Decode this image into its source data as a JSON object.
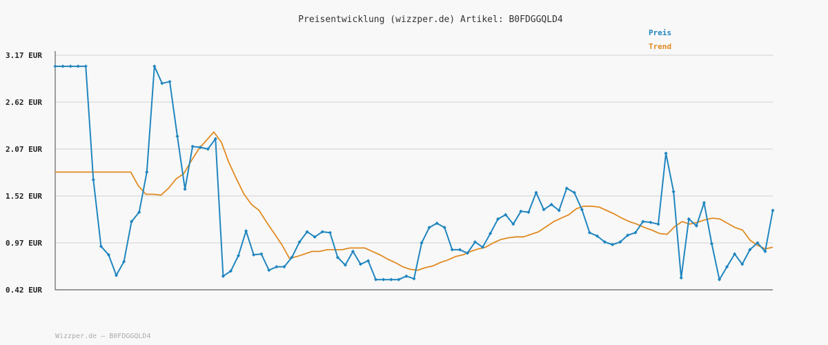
{
  "chart_data": {
    "type": "line",
    "title": "Preisentwicklung (wizzper.de) Artikel: B0FDGGQLD4",
    "footer": "Wizzper.de – B0FDGGQLD4",
    "ylabel": "",
    "xlabel": "",
    "ylim": [
      0.42,
      3.17
    ],
    "y_ticks": [
      {
        "value": 3.17,
        "label": "3.17 EUR"
      },
      {
        "value": 2.62,
        "label": "2.62 EUR"
      },
      {
        "value": 2.07,
        "label": "2.07 EUR"
      },
      {
        "value": 1.52,
        "label": "1.52 EUR"
      },
      {
        "value": 0.97,
        "label": "0.97 EUR"
      },
      {
        "value": 0.42,
        "label": "0.42 EUR"
      }
    ],
    "grid": true,
    "legend": "top-right",
    "colors": {
      "preis": "#1f85bf",
      "trend": "#e08a20",
      "grid": "#dddddd",
      "axis": "#444444"
    },
    "series": [
      {
        "name": "Preis",
        "values": [
          3.04,
          3.04,
          3.04,
          3.04,
          3.04,
          1.71,
          0.93,
          0.83,
          0.59,
          0.75,
          1.22,
          1.33,
          1.8,
          3.04,
          2.84,
          2.86,
          2.22,
          1.6,
          2.1,
          2.09,
          2.07,
          2.19,
          0.58,
          0.64,
          0.82,
          1.11,
          0.83,
          0.84,
          0.65,
          0.69,
          0.69,
          0.8,
          0.98,
          1.1,
          1.04,
          1.1,
          1.09,
          0.8,
          0.71,
          0.87,
          0.72,
          0.76,
          0.54,
          0.54,
          0.54,
          0.54,
          0.58,
          0.55,
          0.97,
          1.15,
          1.2,
          1.15,
          0.89,
          0.89,
          0.85,
          0.98,
          0.92,
          1.08,
          1.25,
          1.3,
          1.19,
          1.34,
          1.33,
          1.56,
          1.36,
          1.42,
          1.35,
          1.61,
          1.56,
          1.36,
          1.09,
          1.05,
          0.98,
          0.95,
          0.98,
          1.06,
          1.09,
          1.22,
          1.21,
          1.19,
          2.02,
          1.57,
          0.56,
          1.25,
          1.17,
          1.44,
          0.96,
          0.54,
          0.69,
          0.84,
          0.72,
          0.89,
          0.97,
          0.87,
          1.35
        ]
      },
      {
        "name": "Trend",
        "values": [
          1.8,
          1.8,
          1.8,
          1.8,
          1.8,
          1.8,
          1.8,
          1.8,
          1.8,
          1.8,
          1.8,
          1.64,
          1.54,
          1.54,
          1.53,
          1.61,
          1.72,
          1.78,
          1.93,
          2.07,
          2.17,
          2.27,
          2.15,
          1.91,
          1.72,
          1.54,
          1.42,
          1.35,
          1.21,
          1.08,
          0.95,
          0.79,
          0.81,
          0.84,
          0.87,
          0.87,
          0.89,
          0.89,
          0.89,
          0.91,
          0.91,
          0.91,
          0.87,
          0.83,
          0.78,
          0.74,
          0.69,
          0.66,
          0.65,
          0.68,
          0.7,
          0.74,
          0.77,
          0.81,
          0.83,
          0.87,
          0.9,
          0.92,
          0.97,
          1.01,
          1.03,
          1.04,
          1.04,
          1.07,
          1.1,
          1.16,
          1.22,
          1.26,
          1.3,
          1.37,
          1.4,
          1.4,
          1.39,
          1.35,
          1.31,
          1.26,
          1.22,
          1.19,
          1.15,
          1.12,
          1.08,
          1.07,
          1.16,
          1.22,
          1.19,
          1.21,
          1.24,
          1.26,
          1.25,
          1.2,
          1.15,
          1.12,
          1.0,
          0.94,
          0.9,
          0.92
        ]
      }
    ]
  }
}
